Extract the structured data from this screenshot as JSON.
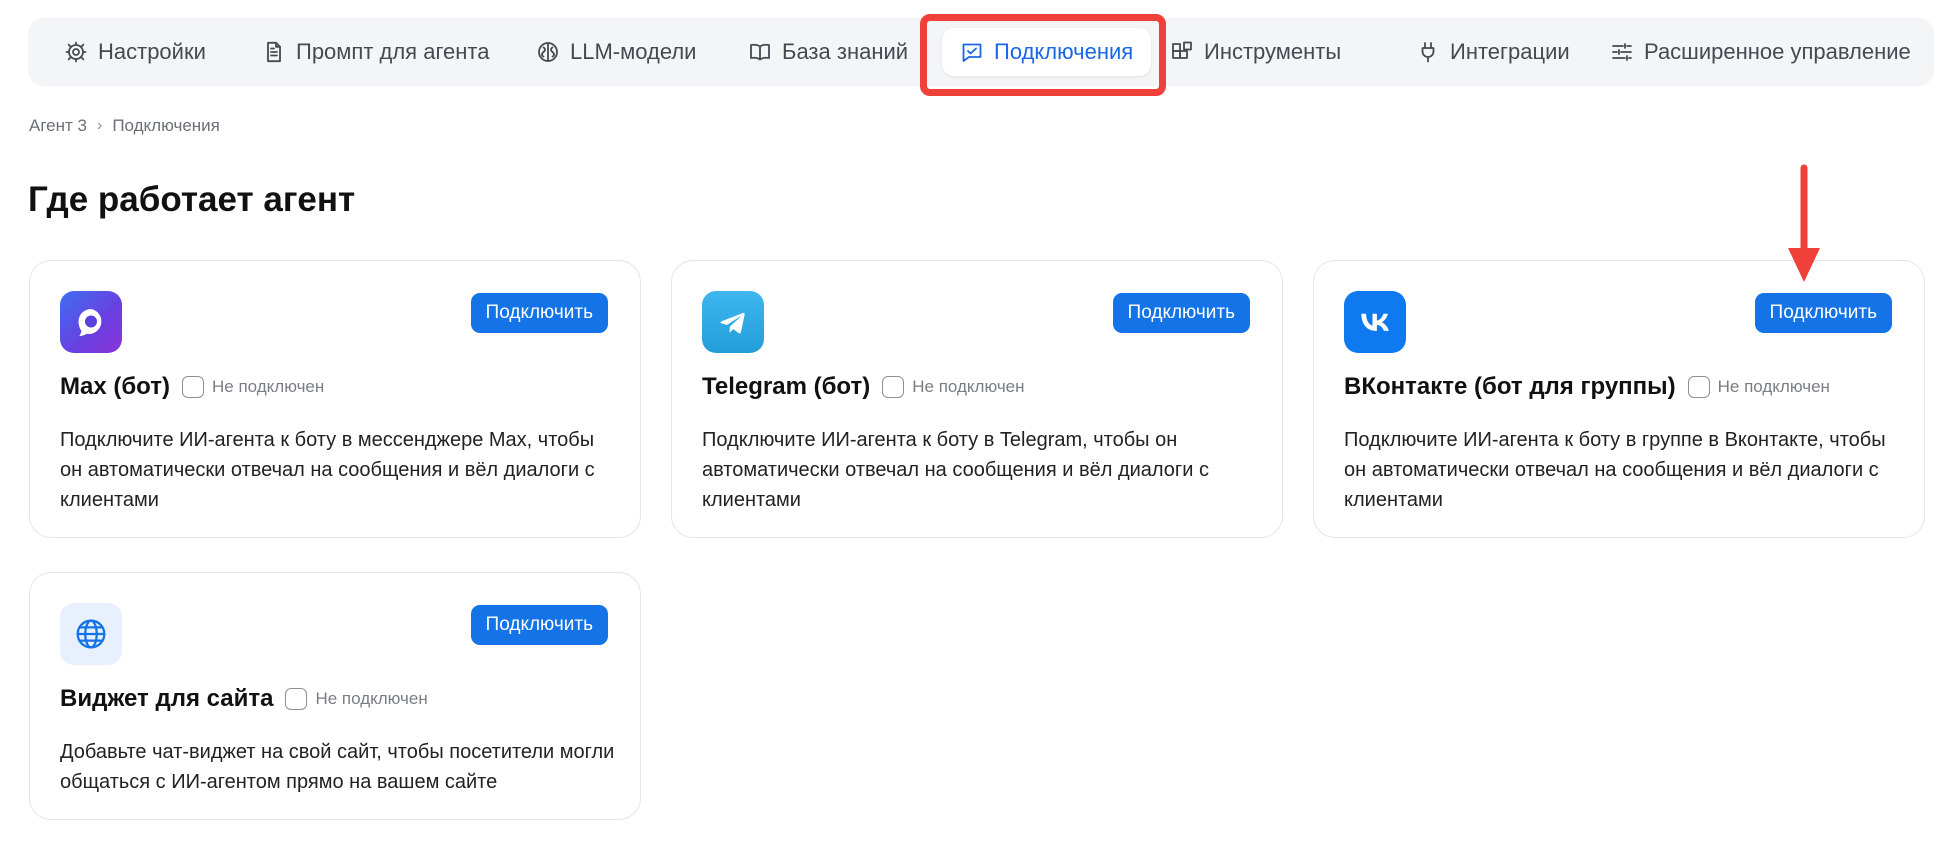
{
  "tabs": [
    {
      "label": "Настройки",
      "icon": "gear-icon"
    },
    {
      "label": "Промпт для агента",
      "icon": "document-icon"
    },
    {
      "label": "LLM-модели",
      "icon": "brain-icon"
    },
    {
      "label": "База знаний",
      "icon": "book-icon"
    },
    {
      "label": "Подключения",
      "icon": "chat-check-icon",
      "active": true
    },
    {
      "label": "Инструменты",
      "icon": "blocks-icon"
    },
    {
      "label": "Интеграции",
      "icon": "plug-icon"
    },
    {
      "label": "Расширенное управление",
      "icon": "sliders-icon"
    }
  ],
  "breadcrumb": {
    "parent": "Агент 3",
    "separator": "›",
    "current": "Подключения"
  },
  "page_title": "Где работает агент",
  "cards": [
    {
      "title": "Max (бот)",
      "status": "Не подключен",
      "button": "Подключить",
      "description": "Подключите ИИ-агента к боту в мессенджере Max, чтобы он автоматически отвечал на сообщения и вёл диалоги с клиентами",
      "icon": "max-logo-icon",
      "color": "#5b3fd9"
    },
    {
      "title": "Telegram (бот)",
      "status": "Не подключен",
      "button": "Подключить",
      "description": "Подключите ИИ-агента к боту в Telegram, чтобы он автоматически отвечал на сообщения и вёл диалоги с клиентами",
      "icon": "telegram-logo-icon",
      "color": "#2aa3e4"
    },
    {
      "title": "ВКонтакте (бот для группы)",
      "status": "Не подключен",
      "button": "Подключить",
      "description": "Подключите ИИ-агента к боту в группе в Вконтакте, чтобы он автоматически отвечал на сообщения и вёл диалоги с клиентами",
      "icon": "vk-logo-icon",
      "color": "#0f7af0"
    },
    {
      "title": "Виджет для сайта",
      "status": "Не подключен",
      "button": "Подключить",
      "description": "Добавьте чат-виджет на свой сайт, чтобы посетители могли общаться с ИИ-агентом прямо на вашем сайте",
      "icon": "globe-icon",
      "color": "#1473e6"
    }
  ],
  "colors": {
    "accent": "#1473e6",
    "highlight": "#f0403a",
    "muted": "#7a7e84"
  }
}
